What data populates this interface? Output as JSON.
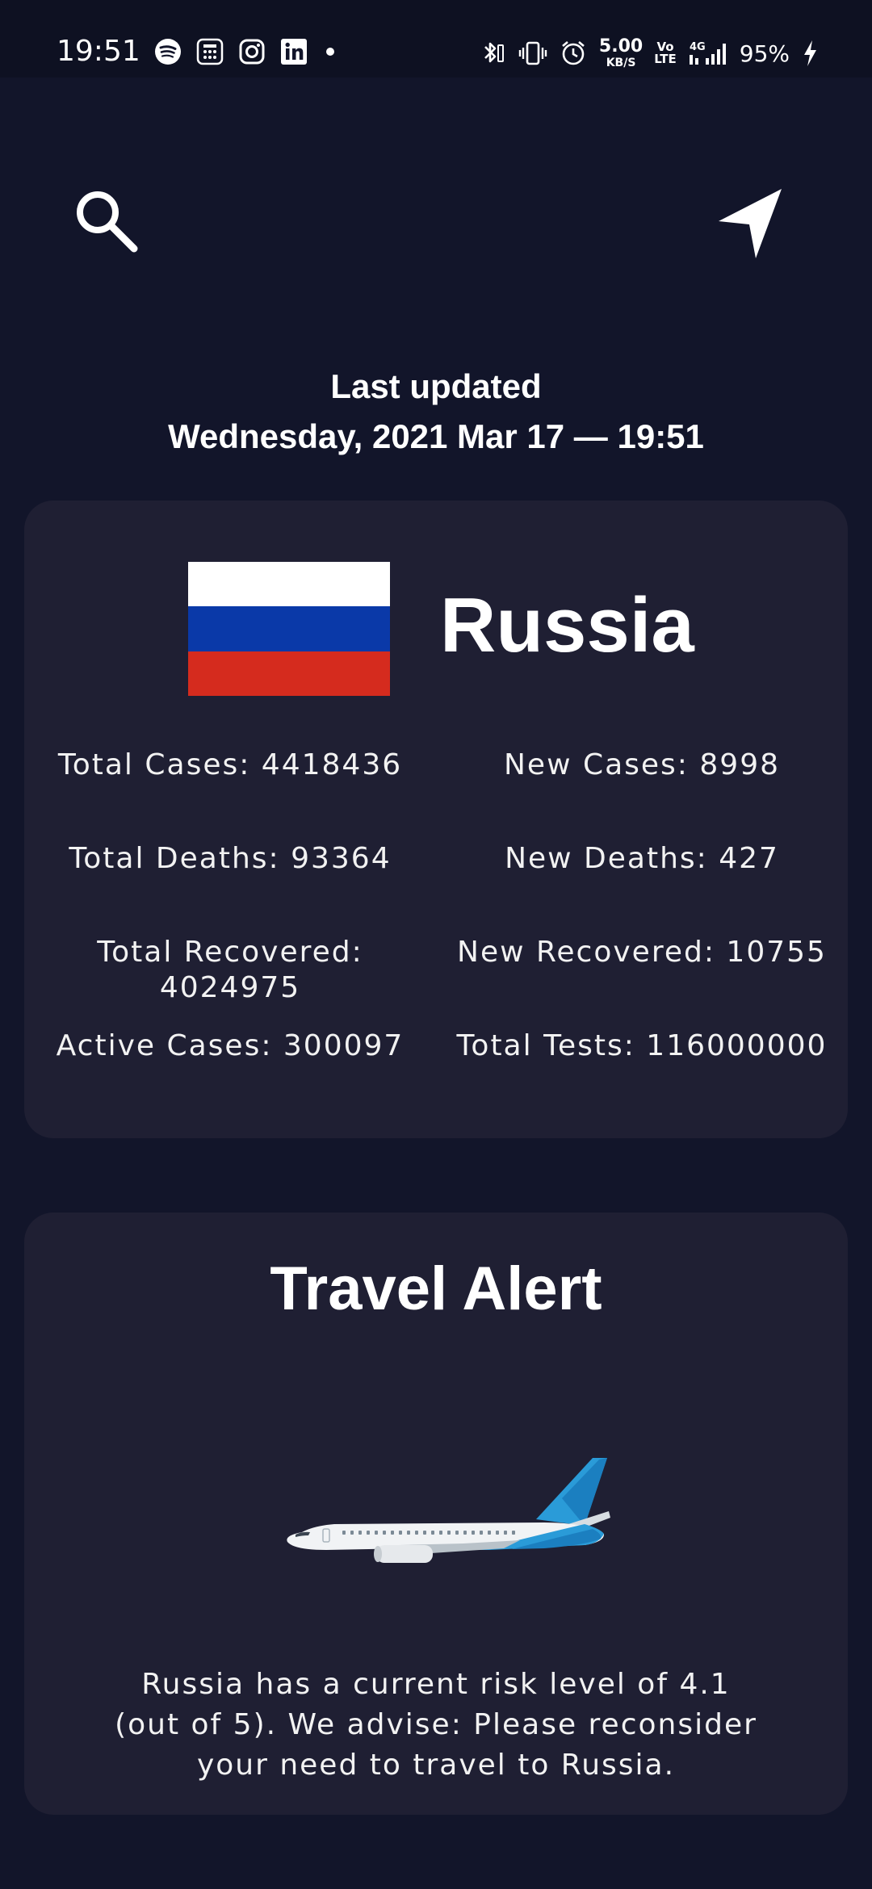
{
  "status_bar": {
    "time": "19:51",
    "app_icons": [
      "spotify-icon",
      "calculator-icon",
      "instagram-icon",
      "linkedin-icon"
    ],
    "net_speed_value": "5.00",
    "net_speed_unit": "KB/S",
    "volte_top": "Vo",
    "volte_bottom": "LTE",
    "signal_label": "4G",
    "battery": "95%"
  },
  "header": {
    "last_updated_label": "Last updated",
    "last_updated_value": "Wednesday, 2021 Mar 17 — 19:51"
  },
  "country": {
    "name": "Russia",
    "flag_colors": [
      "#ffffff",
      "#0a39a8",
      "#d52b1e"
    ],
    "stats": [
      {
        "text": "Total Cases: 4418436"
      },
      {
        "text": "New Cases: 8998"
      },
      {
        "text": "Total Deaths: 93364"
      },
      {
        "text": "New Deaths: 427"
      },
      {
        "text": "Total Recovered: 4024975"
      },
      {
        "text": "New Recovered: 10755"
      },
      {
        "text": "Active Cases: 300097"
      },
      {
        "text": "Total Tests: 116000000"
      }
    ]
  },
  "travel": {
    "title": "Travel Alert",
    "image": "airplane-icon",
    "message": "Russia has a current risk level of 4.1 (out of 5). We advise: Please reconsider your need to travel to Russia."
  },
  "colors": {
    "background": "#12152a",
    "card": "#1f1f33",
    "text": "#ffffff"
  }
}
